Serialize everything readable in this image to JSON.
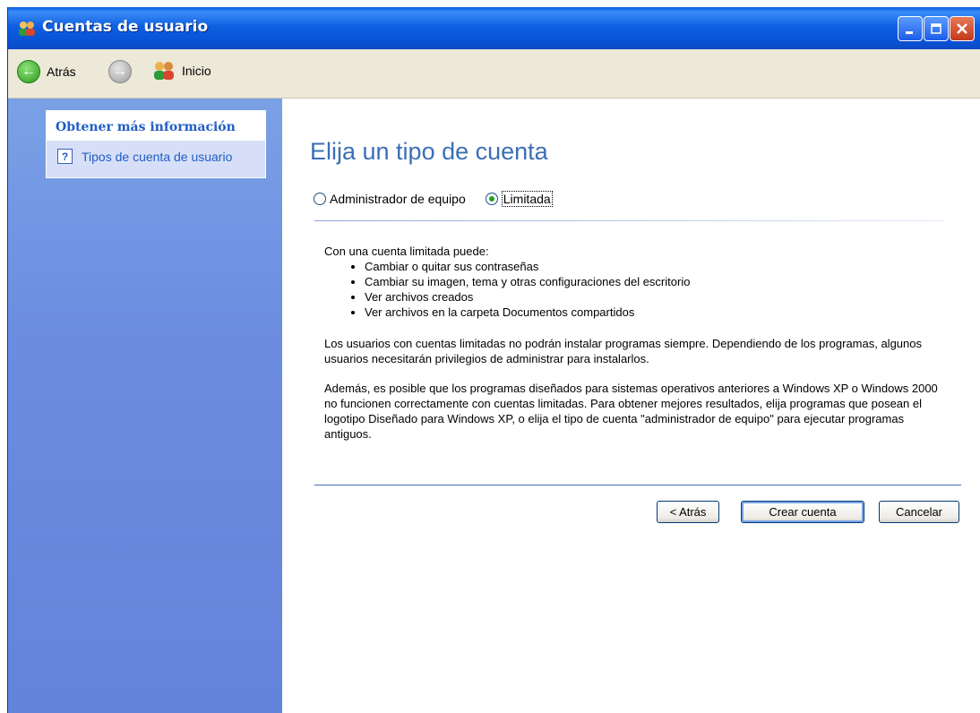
{
  "window": {
    "title": "Cuentas de usuario",
    "controls": {
      "minimize": "minimize",
      "maximize": "maximize",
      "close": "close"
    }
  },
  "toolbar": {
    "back_label": "Atrás",
    "home_label": "Inicio"
  },
  "sidebar": {
    "panel_title": "Obtener más información",
    "items": [
      {
        "label": "Tipos de cuenta de usuario",
        "icon": "help-icon"
      }
    ]
  },
  "main": {
    "heading": "Elija un tipo de cuenta",
    "account_types": [
      {
        "label": "Administrador de equipo",
        "selected": false
      },
      {
        "label": "Limitada",
        "selected": true
      }
    ],
    "intro": "Con una cuenta limitada puede:",
    "bullets": [
      "Cambiar o quitar sus contraseñas",
      "Cambiar su imagen, tema y otras configuraciones del escritorio",
      "Ver archivos creados",
      "Ver archivos en la carpeta Documentos compartidos"
    ],
    "paragraph1": "Los usuarios con cuentas limitadas no podrán instalar programas siempre. Dependiendo de los programas, algunos usuarios necesitarán privilegios de administrar para instalarlos.",
    "paragraph2": "Además, es posible que los programas diseñados para sistemas operativos anteriores a Windows XP o Windows 2000 no funcionen correctamente con cuentas limitadas. Para obtener mejores resultados, elija programas que posean el logotipo Diseñado para Windows XP, o elija el tipo de cuenta \"administrador de equipo\" para ejecutar programas antiguos.",
    "buttons": {
      "back": "< Atrás",
      "create": "Crear cuenta",
      "cancel": "Cancelar"
    }
  },
  "colors": {
    "titlebar": "#0952d6",
    "sidebar": "#6b8ce0",
    "heading": "#3b6fb5",
    "link": "#215dc6"
  }
}
